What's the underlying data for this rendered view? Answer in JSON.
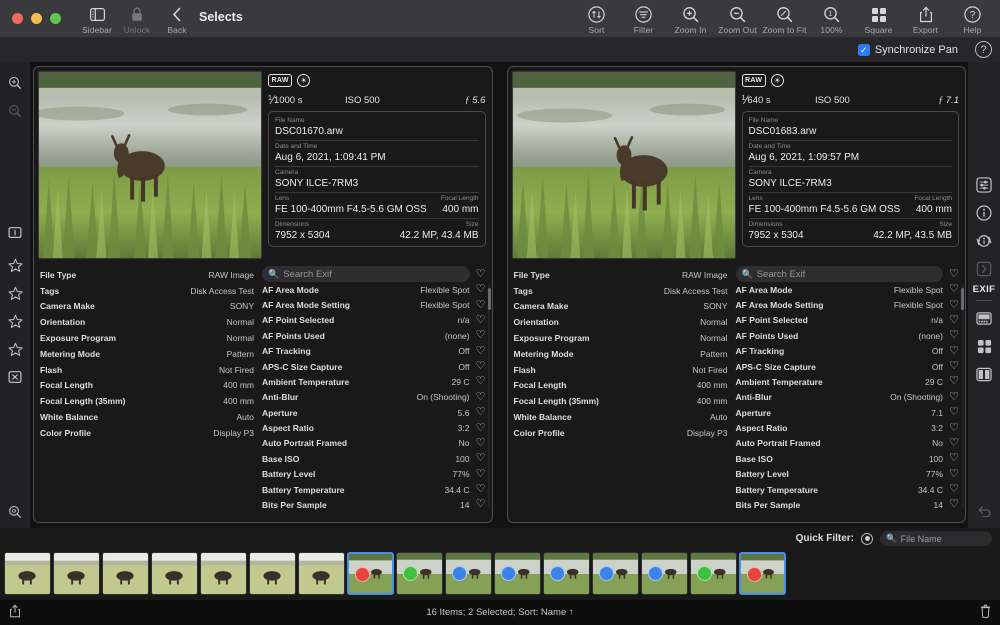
{
  "window": {
    "title": "Selects",
    "traffic_lights": [
      "close",
      "minimize",
      "zoom"
    ]
  },
  "toolbar": {
    "left_buttons": [
      {
        "name": "sidebar",
        "label": "Sidebar",
        "icon": "sidebar-icon",
        "enabled": true
      },
      {
        "name": "unlock",
        "label": "Unlock",
        "icon": "lock-icon",
        "enabled": false
      },
      {
        "name": "back",
        "label": "Back",
        "icon": "chevron-left-icon",
        "enabled": true
      }
    ],
    "right_buttons": [
      {
        "name": "sort",
        "label": "Sort",
        "icon": "sort-icon"
      },
      {
        "name": "filter",
        "label": "Filter",
        "icon": "filter-icon"
      },
      {
        "name": "zoom-in",
        "label": "Zoom In",
        "icon": "zoom-in-icon"
      },
      {
        "name": "zoom-out",
        "label": "Zoom Out",
        "icon": "zoom-out-icon"
      },
      {
        "name": "zoom-to-fit",
        "label": "Zoom to Fit",
        "icon": "zoom-fit-icon"
      },
      {
        "name": "zoom-100",
        "label": "100%",
        "icon": "zoom-100-icon"
      },
      {
        "name": "square",
        "label": "Square",
        "icon": "grid-icon"
      },
      {
        "name": "export",
        "label": "Export",
        "icon": "export-icon"
      },
      {
        "name": "help",
        "label": "Help",
        "icon": "help-icon"
      }
    ]
  },
  "subbar": {
    "synchronize_pan_label": "Synchronize Pan",
    "synchronize_pan_checked": true,
    "help_icon": "help-circle-icon"
  },
  "left_rail": {
    "icons": [
      "zoom-in-icon",
      "zoom-out-icon",
      "flag-icon",
      "star-icon",
      "star-icon",
      "star-icon",
      "star-icon",
      "reject-icon",
      "loupe-icon",
      "loupe-one-icon"
    ]
  },
  "right_rail": {
    "icons": [
      "adjust-icon",
      "info-icon",
      "info-rotate-icon",
      "chevron-right-box-icon"
    ],
    "exif_label": "EXIF",
    "view_icons": [
      "filmstrip-view-icon",
      "grid-view-icon",
      "split-view-icon"
    ],
    "history_icons": [
      "undo-icon",
      "redo-icon"
    ]
  },
  "panes": [
    {
      "id": "pane-left",
      "photo_alt": "moose standing in marsh grass at pond edge",
      "badges": {
        "raw": "RAW",
        "round_icon": "color-profile-icon"
      },
      "exposure": {
        "shutter_num": "1",
        "shutter_den": "1000 s",
        "iso": "ISO 500",
        "aperture": "5.6",
        "f_symbol": "ƒ"
      },
      "info_card": [
        {
          "label": "File Name",
          "value": "DSC01670.arw"
        },
        {
          "label": "Date and Time",
          "value": "Aug 6, 2021, 1:09:41 PM"
        },
        {
          "label": "Camera",
          "value": "SONY ILCE-7RM3"
        },
        {
          "label": "Lens",
          "value": "FE 100-400mm F4.5-5.6 GM OSS",
          "label2": "Focal Length",
          "value2": "400 mm"
        },
        {
          "label": "Dimensions",
          "value": "7952 x 5304",
          "label2": "Size",
          "value2": "42.2 MP, 43.4 MB"
        }
      ],
      "summary": [
        {
          "key": "File Type",
          "value": "RAW Image"
        },
        {
          "key": "Tags",
          "value": "Disk Access Test"
        },
        {
          "key": "Camera Make",
          "value": "SONY"
        },
        {
          "key": "Orientation",
          "value": "Normal"
        },
        {
          "key": "Exposure Program",
          "value": "Normal"
        },
        {
          "key": "Metering Mode",
          "value": "Pattern"
        },
        {
          "key": "Flash",
          "value": "Not Fired"
        },
        {
          "key": "Focal Length",
          "value": "400 mm"
        },
        {
          "key": "Focal Length (35mm)",
          "value": "400 mm"
        },
        {
          "key": "White Balance",
          "value": "Auto"
        },
        {
          "key": "Color Profile",
          "value": "Display P3"
        }
      ],
      "search": {
        "placeholder": "Search Exif",
        "icon": "search-icon"
      },
      "exif": [
        {
          "key": "AF Area Mode",
          "value": "Flexible Spot"
        },
        {
          "key": "AF Area Mode Setting",
          "value": "Flexible Spot"
        },
        {
          "key": "AF Point Selected",
          "value": "n/a"
        },
        {
          "key": "AF Points Used",
          "value": "(none)"
        },
        {
          "key": "AF Tracking",
          "value": "Off"
        },
        {
          "key": "APS-C Size Capture",
          "value": "Off"
        },
        {
          "key": "Ambient Temperature",
          "value": "29 C"
        },
        {
          "key": "Anti-Blur",
          "value": "On (Shooting)"
        },
        {
          "key": "Aperture",
          "value": "5.6"
        },
        {
          "key": "Aspect Ratio",
          "value": "3:2"
        },
        {
          "key": "Auto Portrait Framed",
          "value": "No"
        },
        {
          "key": "Base ISO",
          "value": "100"
        },
        {
          "key": "Battery Level",
          "value": "77%"
        },
        {
          "key": "Battery Temperature",
          "value": "34.4 C"
        },
        {
          "key": "Bits Per Sample",
          "value": "14"
        }
      ]
    },
    {
      "id": "pane-right",
      "photo_alt": "moose standing in marsh grass at pond edge",
      "badges": {
        "raw": "RAW",
        "round_icon": "color-profile-icon"
      },
      "exposure": {
        "shutter_num": "1",
        "shutter_den": "640 s",
        "iso": "ISO 500",
        "aperture": "7.1",
        "f_symbol": "ƒ"
      },
      "info_card": [
        {
          "label": "File Name",
          "value": "DSC01683.arw"
        },
        {
          "label": "Date and Time",
          "value": "Aug 6, 2021, 1:09:57 PM"
        },
        {
          "label": "Camera",
          "value": "SONY ILCE-7RM3"
        },
        {
          "label": "Lens",
          "value": "FE 100-400mm F4.5-5.6 GM OSS",
          "label2": "Focal Length",
          "value2": "400 mm"
        },
        {
          "label": "Dimensions",
          "value": "7952 x 5304",
          "label2": "Size",
          "value2": "42.2 MP, 43.5 MB"
        }
      ],
      "summary": [
        {
          "key": "File Type",
          "value": "RAW Image"
        },
        {
          "key": "Tags",
          "value": "Disk Access Test"
        },
        {
          "key": "Camera Make",
          "value": "SONY"
        },
        {
          "key": "Orientation",
          "value": "Normal"
        },
        {
          "key": "Exposure Program",
          "value": "Normal"
        },
        {
          "key": "Metering Mode",
          "value": "Pattern"
        },
        {
          "key": "Flash",
          "value": "Not Fired"
        },
        {
          "key": "Focal Length",
          "value": "400 mm"
        },
        {
          "key": "Focal Length (35mm)",
          "value": "400 mm"
        },
        {
          "key": "White Balance",
          "value": "Auto"
        },
        {
          "key": "Color Profile",
          "value": "Display P3"
        }
      ],
      "search": {
        "placeholder": "Search Exif",
        "icon": "search-icon"
      },
      "exif": [
        {
          "key": "AF Area Mode",
          "value": "Flexible Spot"
        },
        {
          "key": "AF Area Mode Setting",
          "value": "Flexible Spot"
        },
        {
          "key": "AF Point Selected",
          "value": "n/a"
        },
        {
          "key": "AF Points Used",
          "value": "(none)"
        },
        {
          "key": "AF Tracking",
          "value": "Off"
        },
        {
          "key": "APS-C Size Capture",
          "value": "Off"
        },
        {
          "key": "Ambient Temperature",
          "value": "29 C"
        },
        {
          "key": "Anti-Blur",
          "value": "On (Shooting)"
        },
        {
          "key": "Aperture",
          "value": "7.1"
        },
        {
          "key": "Aspect Ratio",
          "value": "3:2"
        },
        {
          "key": "Auto Portrait Framed",
          "value": "No"
        },
        {
          "key": "Base ISO",
          "value": "100"
        },
        {
          "key": "Battery Level",
          "value": "77%"
        },
        {
          "key": "Battery Temperature",
          "value": "34.4 C"
        },
        {
          "key": "Bits Per Sample",
          "value": "14"
        }
      ]
    }
  ],
  "quick_filter": {
    "label": "Quick Filter:",
    "dot_icon": "filter-dot-icon",
    "search_placeholder": "File Name",
    "search_icon": "search-icon"
  },
  "filmstrip": {
    "thumbnails": [
      {
        "index": 1,
        "variant": "field",
        "dot": null,
        "selected": false
      },
      {
        "index": 2,
        "variant": "field",
        "dot": null,
        "selected": false
      },
      {
        "index": 3,
        "variant": "field",
        "dot": null,
        "selected": false
      },
      {
        "index": 4,
        "variant": "field",
        "dot": null,
        "selected": false
      },
      {
        "index": 5,
        "variant": "field",
        "dot": null,
        "selected": false
      },
      {
        "index": 6,
        "variant": "field",
        "dot": null,
        "selected": false
      },
      {
        "index": 7,
        "variant": "field",
        "dot": null,
        "selected": false
      },
      {
        "index": 8,
        "variant": "pond",
        "dot": "#e8453c",
        "selected": true
      },
      {
        "index": 9,
        "variant": "pond",
        "dot": "#3ec13e",
        "selected": false
      },
      {
        "index": 10,
        "variant": "pond",
        "dot": "#3d84e8",
        "selected": false
      },
      {
        "index": 11,
        "variant": "pond",
        "dot": "#3d84e8",
        "selected": false
      },
      {
        "index": 12,
        "variant": "pond",
        "dot": "#3d84e8",
        "selected": false
      },
      {
        "index": 13,
        "variant": "pond",
        "dot": "#3d84e8",
        "selected": false
      },
      {
        "index": 14,
        "variant": "pond",
        "dot": "#3d84e8",
        "selected": false
      },
      {
        "index": 15,
        "variant": "pond",
        "dot": "#3ec13e",
        "selected": false
      },
      {
        "index": 16,
        "variant": "pond",
        "dot": "#e8453c",
        "selected": true
      }
    ]
  },
  "statusbar": {
    "text": "16 Items; 2 Selected; Sort: Name ↑",
    "left_icon": "export-icon",
    "right_icon": "trash-icon"
  },
  "colors": {
    "accent": "#2b7cf6",
    "selection_border": "#4a90e2",
    "titlebar": "#3a3a3c",
    "panel": "#191919",
    "background": "#121212"
  }
}
